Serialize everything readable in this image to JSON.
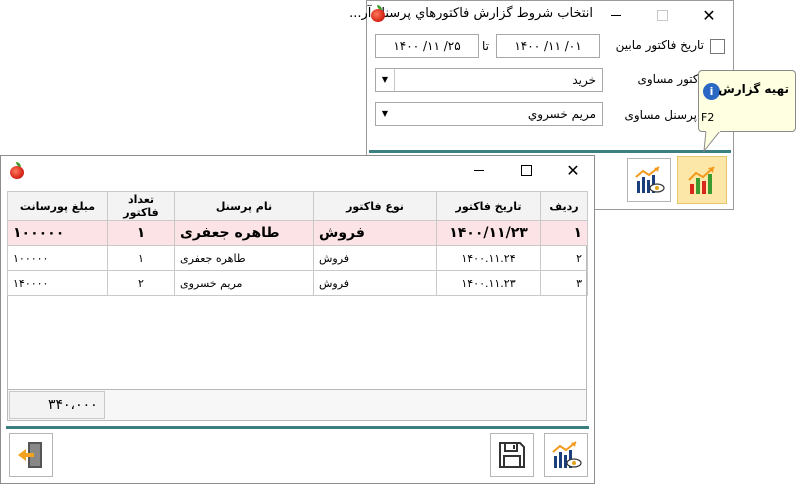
{
  "report_window": {
    "title": "انتخاب شروط گزارش فاکتورهاي پرسنل آر...",
    "date_filter_label": "تاريخ فاکتور مابين",
    "date_from": "۱۴۰۰ /۱۱ /۰۱",
    "date_to_word": "تا",
    "date_to": "۱۴۰۰ /۱۱ /۲۵",
    "invoice_type_label": "فاکتور مساوی",
    "invoice_type_value": "خرید",
    "personnel_label": "پرسنل مساوی",
    "personnel_value": "مریم خسروي"
  },
  "tooltip": {
    "title": "تهیه گزارش",
    "shortcut": "F2"
  },
  "result_window": {
    "columns": [
      "ردیف",
      "تاریخ فاکتور",
      "نوع فاکتور",
      "نام پرسنل",
      "تعداد فاکتور",
      "مبلغ پورسانت"
    ],
    "rows": [
      [
        "۱",
        "۱۴۰۰/۱۱/۲۳",
        "فروش",
        "طاهره جعفری",
        "۱",
        "۱۰۰۰۰۰"
      ],
      [
        "۲",
        "۱۴۰۰.۱۱.۲۴",
        "فروش",
        "طاهره جعفری",
        "۱",
        "۱۰۰۰۰۰"
      ],
      [
        "۳",
        "۱۴۰۰.۱۱.۲۳",
        "فروش",
        "مریم خسروی",
        "۲",
        "۱۴۰۰۰۰"
      ]
    ],
    "total": "۳۴۰،۰۰۰"
  },
  "colors": {
    "accent_teal": "#3b7f80",
    "selected_row": "#fce3e6",
    "tooltip_bg": "#ffffe1",
    "button_highlight": "#fde7a8"
  }
}
